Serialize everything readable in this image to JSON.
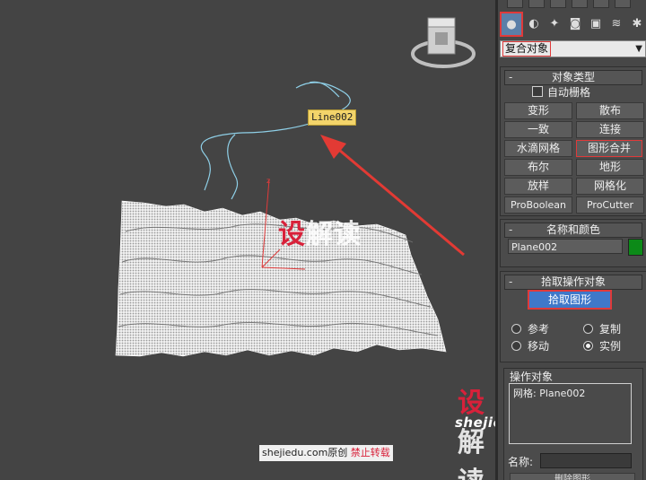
{
  "viewport": {
    "object_label": "Line002",
    "watermark_center": {
      "red": "设",
      "white": "解读"
    },
    "watermark_right": {
      "red": "设",
      "white": "解读"
    },
    "watermark_url": "shejiedu.com",
    "credit": {
      "text": "shejiedu.com原创",
      "red": "禁止转载"
    }
  },
  "panel": {
    "dropdown_value": "复合对象",
    "rollout_object_type": {
      "title": "对象类型",
      "autogrid_label": "自动栅格",
      "buttons": [
        "变形",
        "散布",
        "一致",
        "连接",
        "水滴网格",
        "图形合并",
        "布尔",
        "地形",
        "放样",
        "网格化",
        "ProBoolean",
        "ProCutter"
      ]
    },
    "rollout_name_color": {
      "title": "名称和颜色",
      "name_value": "Plane002",
      "color": "#0c8a18"
    },
    "rollout_pick": {
      "title": "拾取操作对象",
      "pick_button": "拾取图形",
      "radios": [
        {
          "label": "参考",
          "checked": false
        },
        {
          "label": "复制",
          "checked": false
        },
        {
          "label": "移动",
          "checked": false
        },
        {
          "label": "实例",
          "checked": true
        }
      ]
    },
    "operands": {
      "title": "操作对象",
      "items": [
        "网格: Plane002"
      ],
      "name_label": "名称:",
      "bottom_button": "删除图形"
    }
  }
}
